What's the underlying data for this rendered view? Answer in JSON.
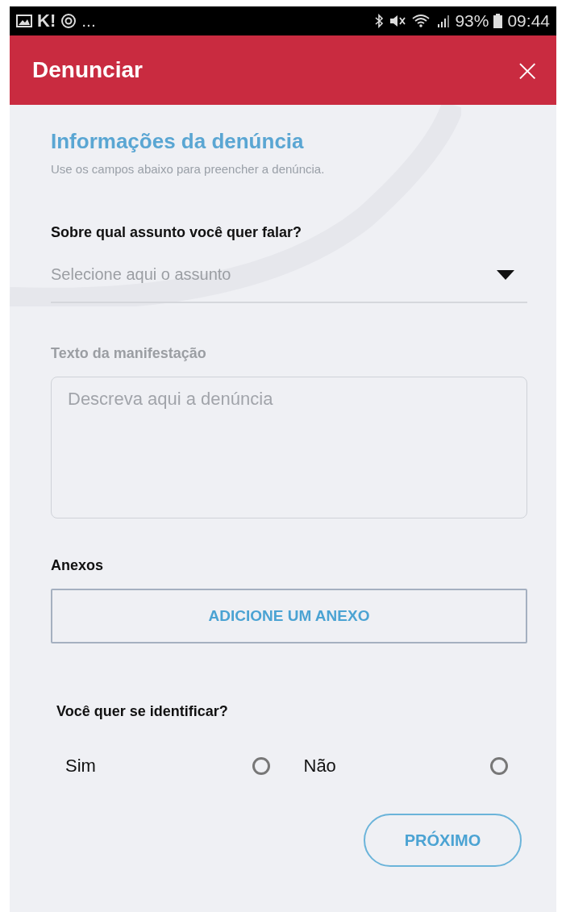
{
  "status_bar": {
    "app_badge": "K!",
    "more": "...",
    "battery": "93%",
    "time": "09:44"
  },
  "header": {
    "title": "Denunciar",
    "close": "×"
  },
  "section": {
    "title": "Informações da denúncia",
    "subtitle": "Use os campos abaixo para preencher a denúncia."
  },
  "subject": {
    "label": "Sobre qual assunto você quer falar?",
    "placeholder": "Selecione aqui o assunto"
  },
  "message": {
    "label": "Texto da manifestação",
    "placeholder": "Descreva aqui a denúncia"
  },
  "attachments": {
    "label": "Anexos",
    "button": "ADICIONE UM ANEXO"
  },
  "identify": {
    "label": "Você quer se identificar?",
    "options": [
      {
        "label": "Sim",
        "selected": false
      },
      {
        "label": "Não",
        "selected": false
      }
    ]
  },
  "next_button": "PRÓXIMO"
}
